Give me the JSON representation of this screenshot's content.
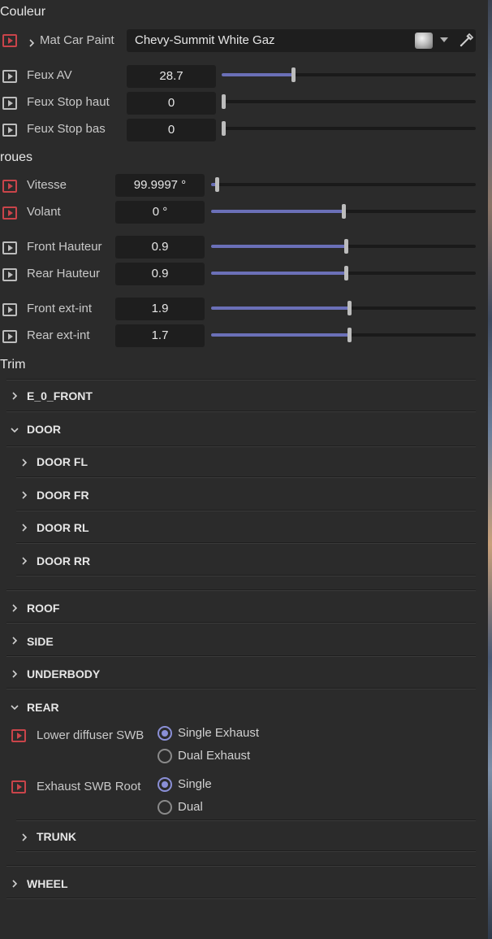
{
  "colors": {
    "accent": "#6b70b8",
    "keyframe_red": "#c9444a",
    "keyframe_gray": "#bdbdbd",
    "panel_bg": "#2b2b2b",
    "field_bg": "#1e1e1e"
  },
  "couleur": {
    "title": "Couleur",
    "mat_label": "Mat Car Paint",
    "mat_value": "Chevy-Summit White Gaz",
    "params": [
      {
        "label": "Feux AV",
        "value": "28.7",
        "slider_fraction": 0.28
      },
      {
        "label": "Feux Stop haut",
        "value": "0",
        "slider_fraction": 0.0
      },
      {
        "label": "Feux Stop bas",
        "value": "0",
        "slider_fraction": 0.0
      }
    ]
  },
  "roues": {
    "title": "roues",
    "params": [
      {
        "label": "Vitesse",
        "value": "99.9997 °",
        "slider_fraction": 0.02
      },
      {
        "label": "Volant",
        "value": "0 °",
        "slider_fraction": 0.5
      },
      {
        "label": "Front Hauteur",
        "value": "0.9",
        "slider_fraction": 0.51
      },
      {
        "label": "Rear Hauteur",
        "value": "0.9",
        "slider_fraction": 0.51
      },
      {
        "label": "Front ext-int",
        "value": "1.9",
        "slider_fraction": 0.52
      },
      {
        "label": "Rear ext-int",
        "value": "1.7",
        "slider_fraction": 0.52
      }
    ]
  },
  "trim": {
    "title": "Trim",
    "groups": {
      "e0_front": "E_0_FRONT",
      "door": "DOOR",
      "door_fl": "DOOR FL",
      "door_fr": "DOOR FR",
      "door_rl": "DOOR RL",
      "door_rr": "DOOR RR",
      "roof": "ROOF",
      "side": "SIDE",
      "underbody": "UNDERBODY",
      "rear": "REAR",
      "trunk": "TRUNK",
      "wheel": "WHEEL"
    },
    "rear_options": {
      "lower_diffuser": {
        "label": "Lower diffuser SWB",
        "options": [
          "Single Exhaust",
          "Dual Exhaust"
        ],
        "selected": "Single Exhaust"
      },
      "exhaust_root": {
        "label": "Exhaust SWB Root",
        "options": [
          "Single",
          "Dual"
        ],
        "selected": "Single"
      }
    }
  }
}
